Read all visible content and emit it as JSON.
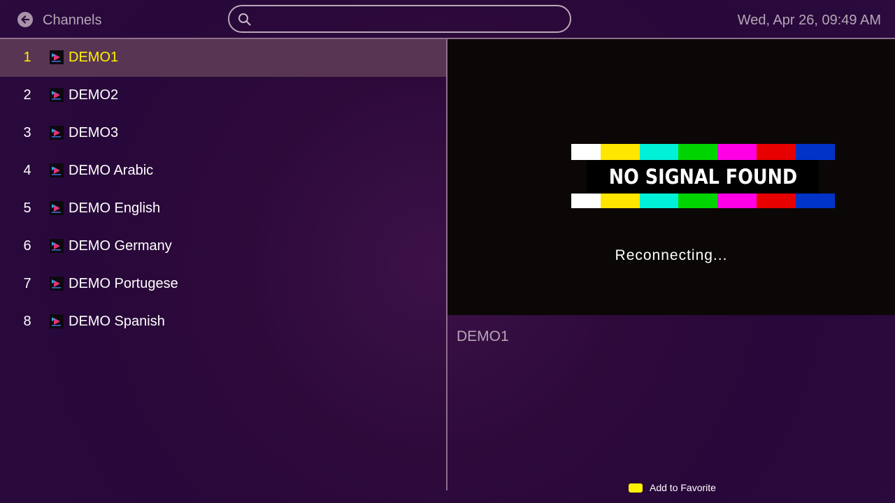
{
  "header": {
    "back_icon": "arrow-left-circle-icon",
    "title": "Channels",
    "search": {
      "icon": "search-icon",
      "value": "",
      "placeholder": ""
    },
    "datetime": "Wed, Apr 26, 09:49 AM"
  },
  "channels": [
    {
      "number": "1",
      "name": "DEMO1",
      "selected": true
    },
    {
      "number": "2",
      "name": "DEMO2",
      "selected": false
    },
    {
      "number": "3",
      "name": "DEMO3",
      "selected": false
    },
    {
      "number": "4",
      "name": "DEMO Arabic",
      "selected": false
    },
    {
      "number": "5",
      "name": "DEMO English",
      "selected": false
    },
    {
      "number": "6",
      "name": "DEMO Germany",
      "selected": false
    },
    {
      "number": "7",
      "name": "DEMO Portugese",
      "selected": false
    },
    {
      "number": "8",
      "name": "DEMO Spanish",
      "selected": false
    }
  ],
  "player": {
    "no_signal_text": "NO SIGNAL FOUND",
    "status": "Reconnecting...",
    "bar_colors": [
      "#ffffff",
      "#ffe600",
      "#00f0d8",
      "#00d400",
      "#ff00e6",
      "#e60000",
      "#0033c8"
    ],
    "now_playing": "DEMO1"
  },
  "footer": {
    "hint_color": "#fff200",
    "hint_label": "Add to Favorite"
  },
  "colors": {
    "background": "#2e0a3b",
    "selected_row": "#583553",
    "selected_text": "#fff200",
    "muted_text": "#b6a6b6"
  }
}
